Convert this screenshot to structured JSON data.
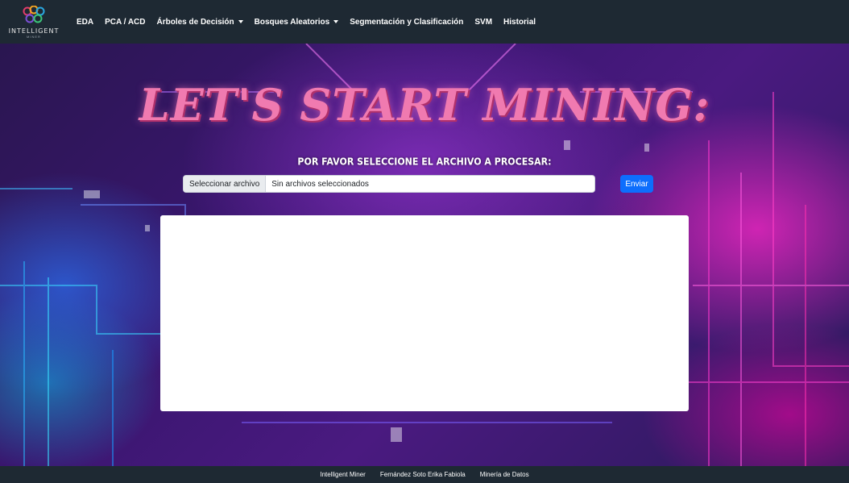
{
  "brand": {
    "name": "INTELLIGENT",
    "subname": "MINER",
    "logo_icon": "molecule-rings-icon",
    "logo_colors": [
      "#e23c6b",
      "#f5a623",
      "#2aa7e0",
      "#7b4fd6",
      "#3cc67a"
    ]
  },
  "nav": {
    "items": [
      {
        "label": "EDA",
        "dropdown": false
      },
      {
        "label": "PCA / ACD",
        "dropdown": false
      },
      {
        "label": "Árboles de Decisión",
        "dropdown": true
      },
      {
        "label": "Bosques Aleatorios",
        "dropdown": true
      },
      {
        "label": "Segmentación y Clasificación",
        "dropdown": false
      },
      {
        "label": "SVM",
        "dropdown": false
      },
      {
        "label": "Historial",
        "dropdown": false
      }
    ]
  },
  "hero": {
    "title": "LET'S START MINING:",
    "subtitle": "POR FAVOR SELECCIONE EL ARCHIVO A PROCESAR:",
    "file_button_label": "Seleccionar archivo",
    "file_name_text": "Sin archivos seleccionados",
    "submit_label": "Enviar"
  },
  "footer": {
    "items": [
      "Intelligent Miner",
      "Fernández Soto Erika Fabiola",
      "Minería de Datos"
    ]
  },
  "colors": {
    "navbar_bg": "#1e2933",
    "title_pink": "#f07ab0",
    "button_blue": "#0d6efd"
  }
}
